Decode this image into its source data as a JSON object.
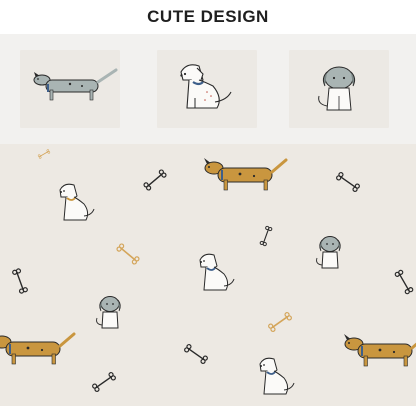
{
  "header": {
    "title": "CUTE DESIGN"
  },
  "swatches": [
    {
      "icon": "dachshund-icon"
    },
    {
      "icon": "sitting-terrier-icon"
    },
    {
      "icon": "gray-puppy-icon"
    }
  ],
  "fabric": {
    "icon_set": [
      "dachshund-icon",
      "terrier-icon",
      "gray-puppy-icon",
      "bone-icon"
    ]
  },
  "colors": {
    "dog_tan": "#c9963f",
    "dog_gray": "#a9b4b3",
    "dog_blue_collar": "#3e5f8a",
    "outline": "#2a2a2a",
    "background": "#ede9e3"
  }
}
